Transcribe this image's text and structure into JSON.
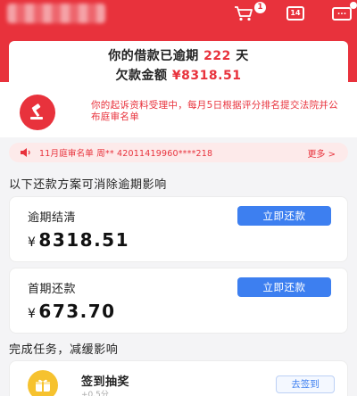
{
  "header": {
    "cart_badge": "1",
    "calendar_label": "14",
    "message_label": "..."
  },
  "overdue": {
    "prefix": "你的借款已逾期",
    "days": "222",
    "days_unit": "天",
    "amount_prefix": "欠款金额",
    "amount": "¥8318.51"
  },
  "notice": {
    "text": "你的起诉资料受理中，每月5日根据评分排名提交法院并公布庭审名单"
  },
  "ticker": {
    "text": "11月庭审名单 周** 42011419960****218",
    "more": "更多 >"
  },
  "plans": {
    "title": "以下还款方案可消除逾期影响",
    "items": [
      {
        "label": "逾期结清",
        "currency": "¥",
        "amount": "8318.51",
        "button": "立即还款"
      },
      {
        "label": "首期还款",
        "currency": "¥",
        "amount": "673.70",
        "button": "立即还款"
      }
    ]
  },
  "tasks": {
    "title": "完成任务，减缓影响",
    "items": [
      {
        "title": "签到抽奖",
        "sub": "+0.5分",
        "button": "去签到"
      }
    ]
  },
  "colors": {
    "brand_red": "#e8323c",
    "button_blue": "#3d7ff0",
    "task_yellow": "#f6c22f"
  },
  "icons": [
    "cart-icon",
    "calendar-icon",
    "message-icon",
    "gavel-icon",
    "speaker-icon",
    "gift-icon"
  ]
}
